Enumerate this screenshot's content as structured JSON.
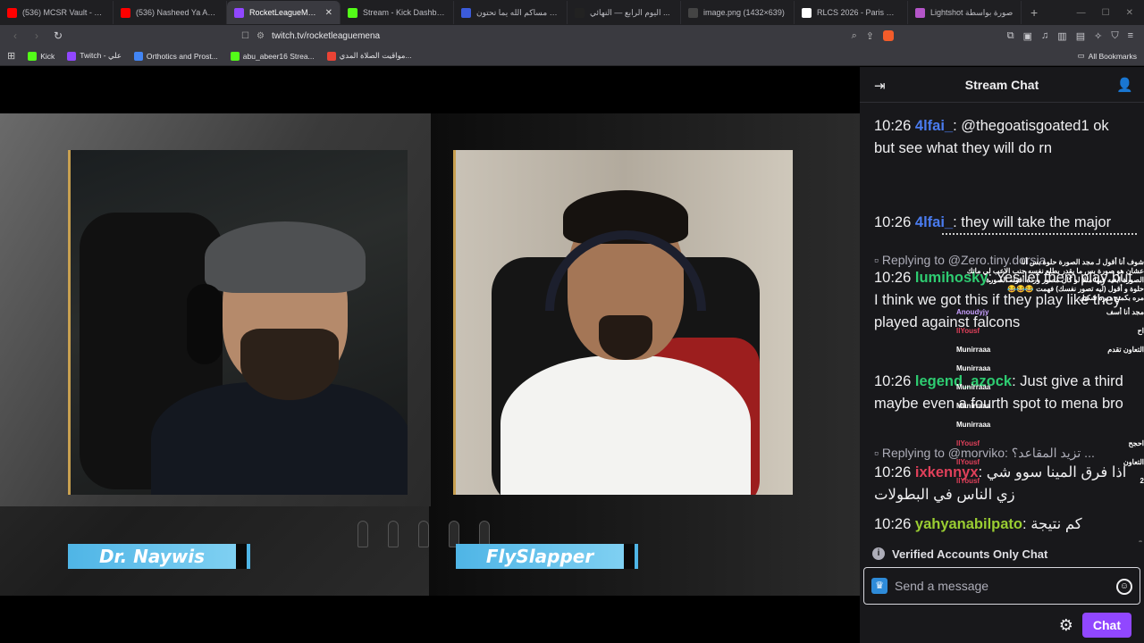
{
  "browser": {
    "tabs": [
      {
        "label": "(536) MCSR Vault - YouTube",
        "color": "#ff0000"
      },
      {
        "label": "(536) Nasheed Ya Adheem",
        "color": "#ff0000"
      },
      {
        "label": "RocketLeagueMENA",
        "color": "#9147ff",
        "active": true
      },
      {
        "label": "Stream - Kick Dashboard",
        "color": "#53fc18"
      },
      {
        "label": "مساكم الله يما تحتون - ...",
        "color": "#3b5bdb"
      },
      {
        "label": "اليوم الرابع — النهائي ...",
        "color": "#222222"
      },
      {
        "label": "image.png (1432×639)",
        "color": "#444444"
      },
      {
        "label": "RLCS 2026 - Paris Major R...",
        "color": "#ffffff"
      },
      {
        "label": "Lightshot صورة بواسطة",
        "color": "#b455c8"
      }
    ],
    "close_glyph": "✕",
    "newtab_glyph": "+",
    "url": "twitch.tv/rocketleaguemena",
    "bookmarks": [
      {
        "label": "Kick",
        "color": "#53fc18"
      },
      {
        "label": "Twitch - علي",
        "color": "#9147ff"
      },
      {
        "label": "Orthotics and Prost...",
        "color": "#4285f4"
      },
      {
        "label": "abu_abeer16 Strea...",
        "color": "#53fc18"
      },
      {
        "label": "مواقيت الصلاة المدي...",
        "color": "#ea4335"
      }
    ],
    "all_bookmarks": "All Bookmarks"
  },
  "video": {
    "left_name": "Dr. Naywis",
    "right_name": "FlySlapper"
  },
  "chat": {
    "title": "Stream Chat",
    "messages": [
      {
        "time": "10:26",
        "user": "4lfai_",
        "user_color": "#4a7cf0",
        "text": ": @thegoatisgoated1 ok but see what they will do rn"
      },
      {
        "time": "10:26",
        "user": "4lfai_",
        "user_color": "#4a7cf0",
        "text": ": they will take the major"
      },
      {
        "time": "10:26",
        "user": "lumihosky",
        "user_color": "#2ecc71",
        "text": ": Yes let them play but I think we got this if they play like they played against falcons"
      },
      {
        "time": "10:26",
        "user": "legend_azock",
        "user_color": "#2ecc71",
        "text": ": Just give a third maybe even a fourth spot to mena bro"
      },
      {
        "time": "10:26",
        "user": "ixkennyx",
        "user_color": "#e0405a",
        "text": ": اذا فرق المينا سوو شي زي الناس في البطولات"
      },
      {
        "time": "10:26",
        "user": "yahyanabilpato",
        "user_color": "#9acd32",
        "text": ": كم نتيجة"
      },
      {
        "time": "10:26",
        "user": "yahyanabilpato",
        "user_color": "#9acd32",
        "text": ": ??"
      }
    ],
    "replies": [
      "Replying to @Zero.tiny.dorsia",
      "Replying to @morviko: تزيد المقاعد؟ ..."
    ],
    "overlay": {
      "line1": "شوف أنا أقول لـ مجد الصورة حلوة بس أنا",
      "line2": "عشان هو صورة بس ما يقدر يطلع نفسه جنب الاعب لي ماتك",
      "line3": "الصورة ابغيه فيها مثلا لو كان مصور ورده أقوله الصورة",
      "line4": "حلوة و أقول (ليه تصور نفسك) فهمت 😂😂😂",
      "line5": "مره بكمنج دبره شكيل",
      "names": [
        "Anoudyjy",
        "llYousf",
        "Munirraaa",
        "Munirraaa",
        "Munirraaa",
        "Munirraaa",
        "Munirraaa",
        "llYousf",
        "llYousf",
        "llYousf"
      ],
      "snips": [
        "مجد أنا أسف",
        "اح",
        "التعاون تقدم",
        "",
        "",
        "",
        "",
        "احجح",
        "التعاون",
        "2"
      ]
    },
    "verified_label": "Verified Accounts Only Chat",
    "input_placeholder": "Send a message",
    "chat_button": "Chat"
  }
}
